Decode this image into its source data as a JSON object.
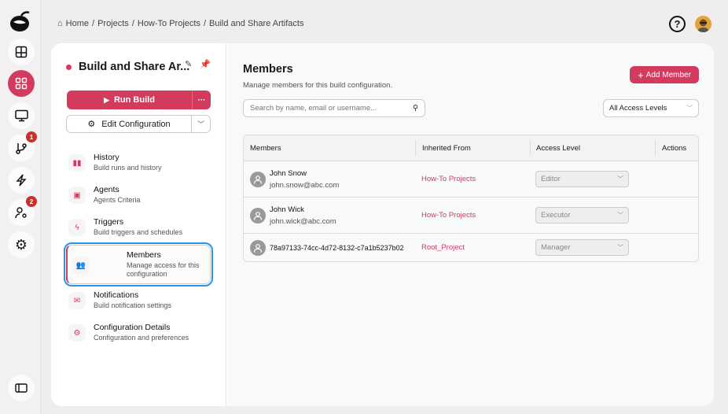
{
  "rail": {
    "badges": {
      "git": "1",
      "users": "2"
    }
  },
  "breadcrumb": [
    "Home",
    "/",
    "Projects",
    "/",
    "How-To Projects",
    "/",
    "Build and Share Artifacts"
  ],
  "header": {
    "help": "?"
  },
  "config": {
    "title": "Build and Share Ar...",
    "run_label": "Run Build",
    "more": "···",
    "edit_label": "Edit Configuration"
  },
  "nav": [
    {
      "title": "History",
      "sub": "Build runs and history"
    },
    {
      "title": "Agents",
      "sub": "Agents Criteria"
    },
    {
      "title": "Triggers",
      "sub": "Build triggers and schedules"
    },
    {
      "title": "Members",
      "sub": "Manage access for this configuration"
    },
    {
      "title": "Notifications",
      "sub": "Build notification settings"
    },
    {
      "title": "Configuration Details",
      "sub": "Configuration and preferences"
    }
  ],
  "main": {
    "title": "Members",
    "subtitle": "Manage members for this build configuration.",
    "add_label": "Add Member",
    "search_placeholder": "Search by name, email or username...",
    "filter": "All Access Levels",
    "columns": [
      "Members",
      "Inherited From",
      "Access Level",
      "Actions"
    ],
    "rows": [
      {
        "name": "John Snow",
        "email": "john.snow@abc.com",
        "inherited": "How-To Projects",
        "access": "Editor"
      },
      {
        "name": "John Wick",
        "email": "john.wick@abc.com",
        "inherited": "How-To Projects",
        "access": "Executor"
      },
      {
        "name": "78a97133-74cc-4d72-8132-c7a1b5237b02",
        "email": null,
        "inherited": "Root_Project",
        "access": "Manager"
      }
    ]
  },
  "colors": {
    "accent": "#d23b5e",
    "focus": "#2d95e8"
  }
}
